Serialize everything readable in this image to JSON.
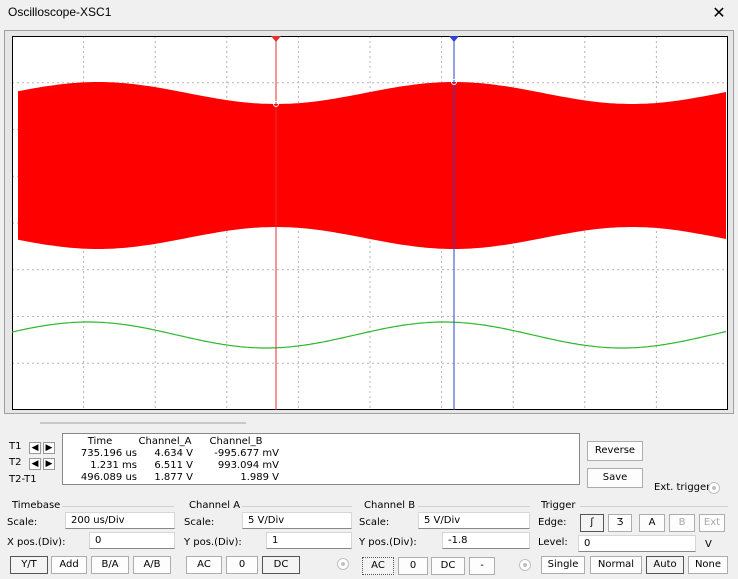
{
  "window": {
    "title": "Oscilloscope-XSC1",
    "close_icon": "close-icon"
  },
  "colors": {
    "channel_a": "#ff0000",
    "channel_b": "#2db82d",
    "cursor_t1": "#e03030",
    "cursor_t2": "#3040d0",
    "screen_bg": "#ffffff"
  },
  "measurements": {
    "headers": [
      "Time",
      "Channel_A",
      "Channel_B"
    ],
    "rows": [
      {
        "label": "T1",
        "time": "735.196 us",
        "channel_a": "4.634 V",
        "channel_b": "-995.677 mV"
      },
      {
        "label": "T2",
        "time": "1.231 ms",
        "channel_a": "6.511 V",
        "channel_b": "993.094 mV"
      },
      {
        "label": "T2-T1",
        "time": "496.089 us",
        "channel_a": "1.877 V",
        "channel_b": "1.989 V"
      }
    ]
  },
  "buttons": {
    "reverse": "Reverse",
    "save": "Save",
    "ext_trigger": "Ext. trigger"
  },
  "timebase": {
    "title": "Timebase",
    "scale_label": "Scale:",
    "scale_value": "200 us/Div",
    "xpos_label": "X pos.(Div):",
    "xpos_value": "0",
    "modes": [
      "Y/T",
      "Add",
      "B/A",
      "A/B"
    ]
  },
  "channel_a": {
    "title": "Channel A",
    "scale_label": "Scale:",
    "scale_value": "5  V/Div",
    "ypos_label": "Y pos.(Div):",
    "ypos_value": "1",
    "coupling": [
      "AC",
      "0",
      "DC"
    ]
  },
  "channel_b": {
    "title": "Channel B",
    "scale_label": "Scale:",
    "scale_value": "5  V/Div",
    "ypos_label": "Y pos.(Div):",
    "ypos_value": "-1.8",
    "coupling": [
      "AC",
      "0",
      "DC",
      "-"
    ]
  },
  "trigger": {
    "title": "Trigger",
    "edge_label": "Edge:",
    "edge_rising": "ʃ",
    "edge_falling": "Ʒ",
    "sources": [
      "A",
      "B",
      "Ext"
    ],
    "level_label": "Level:",
    "level_value": "0",
    "level_unit": "V",
    "modes": [
      "Single",
      "Normal",
      "Auto",
      "None"
    ]
  }
}
